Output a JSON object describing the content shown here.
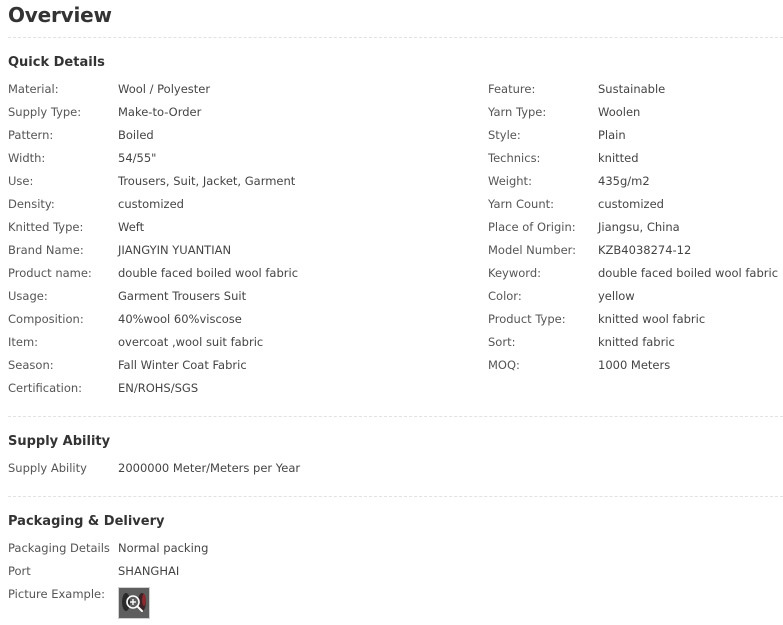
{
  "page_title": "Overview",
  "sections": {
    "quick_details": "Quick Details",
    "supply_ability": "Supply Ability",
    "packaging": "Packaging & Delivery"
  },
  "quick_left": [
    {
      "label": "Material:",
      "value": "Wool / Polyester"
    },
    {
      "label": "Supply Type:",
      "value": "Make-to-Order"
    },
    {
      "label": "Pattern:",
      "value": "Boiled"
    },
    {
      "label": "Width:",
      "value": "54/55\""
    },
    {
      "label": "Use:",
      "value": "Trousers, Suit, Jacket, Garment"
    },
    {
      "label": "Density:",
      "value": "customized"
    },
    {
      "label": "Knitted Type:",
      "value": "Weft"
    },
    {
      "label": "Brand Name:",
      "value": "JIANGYIN YUANTIAN"
    },
    {
      "label": "Product name:",
      "value": "double faced boiled wool fabric"
    },
    {
      "label": "Usage:",
      "value": "Garment Trousers Suit"
    },
    {
      "label": "Composition:",
      "value": "40%wool 60%viscose"
    },
    {
      "label": "Item:",
      "value": "overcoat ,wool suit fabric"
    },
    {
      "label": "Season:",
      "value": "Fall Winter Coat Fabric"
    },
    {
      "label": "Certification:",
      "value": "EN/ROHS/SGS"
    }
  ],
  "quick_right": [
    {
      "label": "Feature:",
      "value": "Sustainable"
    },
    {
      "label": "Yarn Type:",
      "value": "Woolen"
    },
    {
      "label": "Style:",
      "value": "Plain"
    },
    {
      "label": "Technics:",
      "value": "knitted"
    },
    {
      "label": "Weight:",
      "value": "435g/m2"
    },
    {
      "label": "Yarn Count:",
      "value": "customized"
    },
    {
      "label": "Place of Origin:",
      "value": "Jiangsu, China"
    },
    {
      "label": "Model Number:",
      "value": "KZB4038274-12"
    },
    {
      "label": "Keyword:",
      "value": "double faced boiled wool fabric"
    },
    {
      "label": "Color:",
      "value": "yellow"
    },
    {
      "label": "Product Type:",
      "value": "knitted wool fabric"
    },
    {
      "label": "Sort:",
      "value": "knitted fabric"
    },
    {
      "label": "MOQ:",
      "value": "1000 Meters"
    }
  ],
  "supply": [
    {
      "label": "Supply Ability",
      "value": "2000000 Meter/Meters per Year"
    }
  ],
  "packaging": [
    {
      "label": "Packaging Details",
      "value": "Normal packing"
    },
    {
      "label": "Port",
      "value": "SHANGHAI"
    },
    {
      "label": "Picture Example:",
      "value": ""
    }
  ],
  "icons": {
    "thumbnail_zoom": "zoom-in-icon"
  }
}
